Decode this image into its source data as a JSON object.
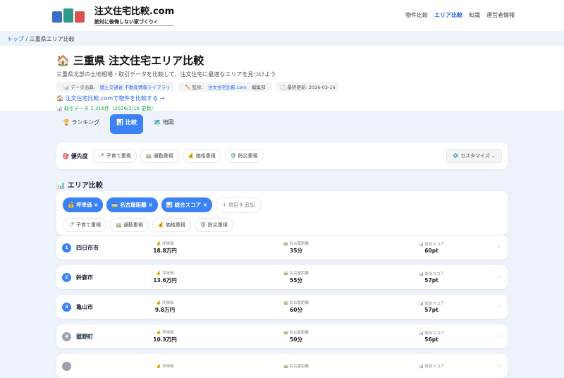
{
  "header": {
    "logo_title": "注文住宅比較.com",
    "logo_sub": "絶対に後悔しない家づくり✔",
    "nav": [
      "物件比較",
      "エリア比較",
      "知識",
      "運営者情報"
    ]
  },
  "breadcrumb": {
    "home": "トップ",
    "sep": "/",
    "current": "三重県エリア比較"
  },
  "hero": {
    "icon": "🏠",
    "title": "三重県 注文住宅エリア比較",
    "desc": "三重県北部の土地相場・取引データを比較して、注文住宅に最適なエリアを見つけよう",
    "source_label": "📊 データ出典: ",
    "source": "国土交通省 不動産情報ライブラリ",
    "supervise_label": "✏️ 監修: ",
    "supervise": "注文住宅比較.com",
    "supervise_suffix": " 編集部",
    "updated": "🕓 最終更新: 2026-03-16",
    "link": "🏠 注文住宅比較.comで物件を比較する →",
    "count": "📊 取引データ 1,316件（2026/2/16 更新）"
  },
  "tabs": [
    "🏆 ランキング",
    "📊 比較",
    "🗺️ 地図"
  ],
  "priority": {
    "label": "🎯 優先度",
    "chips": [
      "🍼 子育て重視",
      "🚃 通勤重視",
      "💰 価格重視",
      "🛡️ 防災重視"
    ],
    "customize": "⚙️ カスタマイズ ⌄"
  },
  "compare": {
    "title": "📊 エリア比較",
    "selected": [
      "💰 坪単価 ×",
      "🚃 名古屋距離 ×",
      "📊 総合スコア ×"
    ],
    "add": "+ 項目を追加",
    "presets": [
      "🍼 子育て重視",
      "🚃 通勤重視",
      "💰 価格重視",
      "🛡️ 防災重視"
    ]
  },
  "columns": [
    "💰 坪単価",
    "🚃 名古屋距離",
    "📊 総合スコア"
  ],
  "rows": [
    {
      "rank": "1",
      "name": "四日市市",
      "price": "18.8万円",
      "distance": "35分",
      "score": "60pt"
    },
    {
      "rank": "2",
      "name": "鈴鹿市",
      "price": "13.6万円",
      "distance": "55分",
      "score": "57pt"
    },
    {
      "rank": "3",
      "name": "亀山市",
      "price": "9.8万円",
      "distance": "60分",
      "score": "57pt"
    },
    {
      "rank": "4",
      "name": "菰野町",
      "price": "10.3万円",
      "distance": "50分",
      "score": "56pt"
    }
  ]
}
